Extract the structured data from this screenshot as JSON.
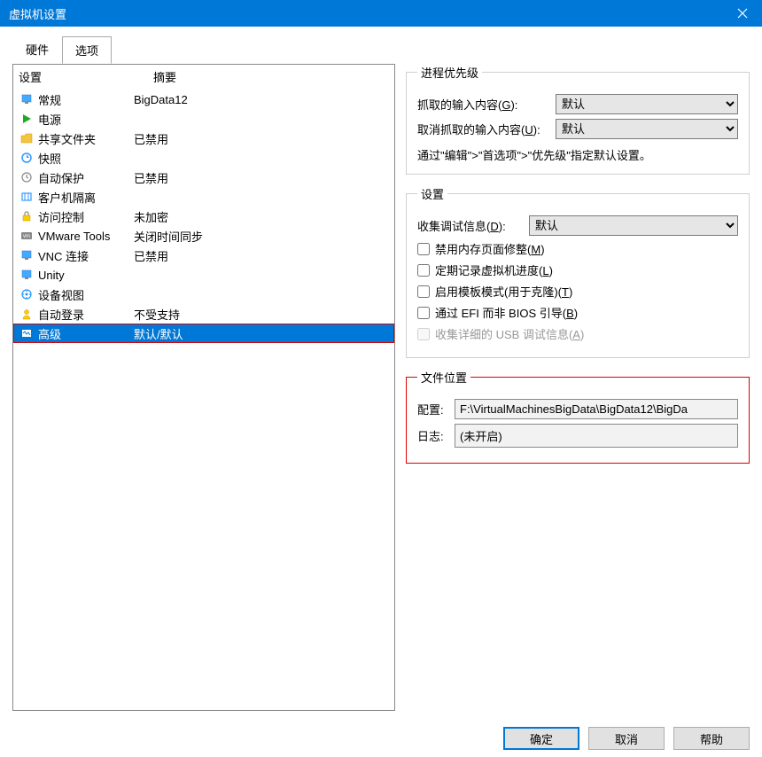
{
  "titlebar": {
    "title": "虚拟机设置"
  },
  "tabs": {
    "hardware": "硬件",
    "options": "选项"
  },
  "list": {
    "header": {
      "setting": "设置",
      "summary": "摘要"
    },
    "rows": [
      {
        "label": "常规",
        "summary": "BigData12",
        "icon": "monitor"
      },
      {
        "label": "电源",
        "summary": "",
        "icon": "play"
      },
      {
        "label": "共享文件夹",
        "summary": "已禁用",
        "icon": "folder"
      },
      {
        "label": "快照",
        "summary": "",
        "icon": "snapshot"
      },
      {
        "label": "自动保护",
        "summary": "已禁用",
        "icon": "clock"
      },
      {
        "label": "客户机隔离",
        "summary": "",
        "icon": "isolate"
      },
      {
        "label": "访问控制",
        "summary": "未加密",
        "icon": "lock"
      },
      {
        "label": "VMware Tools",
        "summary": "关闭时间同步",
        "icon": "vmw"
      },
      {
        "label": "VNC 连接",
        "summary": "已禁用",
        "icon": "monitor"
      },
      {
        "label": "Unity",
        "summary": "",
        "icon": "monitor"
      },
      {
        "label": "设备视图",
        "summary": "",
        "icon": "device"
      },
      {
        "label": "自动登录",
        "summary": "不受支持",
        "icon": "user"
      },
      {
        "label": "高级",
        "summary": "默认/默认",
        "icon": "adv"
      }
    ]
  },
  "priority": {
    "legend": "进程优先级",
    "grabbed_label": "抓取的输入内容(",
    "grabbed_key": "G",
    "grabbed_after": "):",
    "ungrabbed_label": "取消抓取的输入内容(",
    "ungrabbed_key": "U",
    "ungrabbed_after": "):",
    "default_option": "默认",
    "note": "通过\"编辑\">\"首选项\">\"优先级\"指定默认设置。"
  },
  "settings": {
    "legend": "设置",
    "debug_label": "收集调试信息(",
    "debug_key": "D",
    "debug_after": "):",
    "default_option": "默认",
    "cb1_a": "禁用内存页面修整(",
    "cb1_k": "M",
    "cb1_b": ")",
    "cb2_a": "定期记录虚拟机进度(",
    "cb2_k": "L",
    "cb2_b": ")",
    "cb3_a": "启用模板模式(用于克隆)(",
    "cb3_k": "T",
    "cb3_b": ")",
    "cb4_a": "通过 EFI 而非 BIOS 引导(",
    "cb4_k": "B",
    "cb4_b": ")",
    "cb5_a": "收集详细的 USB 调试信息(",
    "cb5_k": "A",
    "cb5_b": ")"
  },
  "fileloc": {
    "legend": "文件位置",
    "config_label": "配置:",
    "config_value": "F:\\VirtualMachinesBigData\\BigData12\\BigDa",
    "log_label": "日志:",
    "log_value": "(未开启)"
  },
  "buttons": {
    "ok": "确定",
    "cancel": "取消",
    "help": "帮助"
  }
}
